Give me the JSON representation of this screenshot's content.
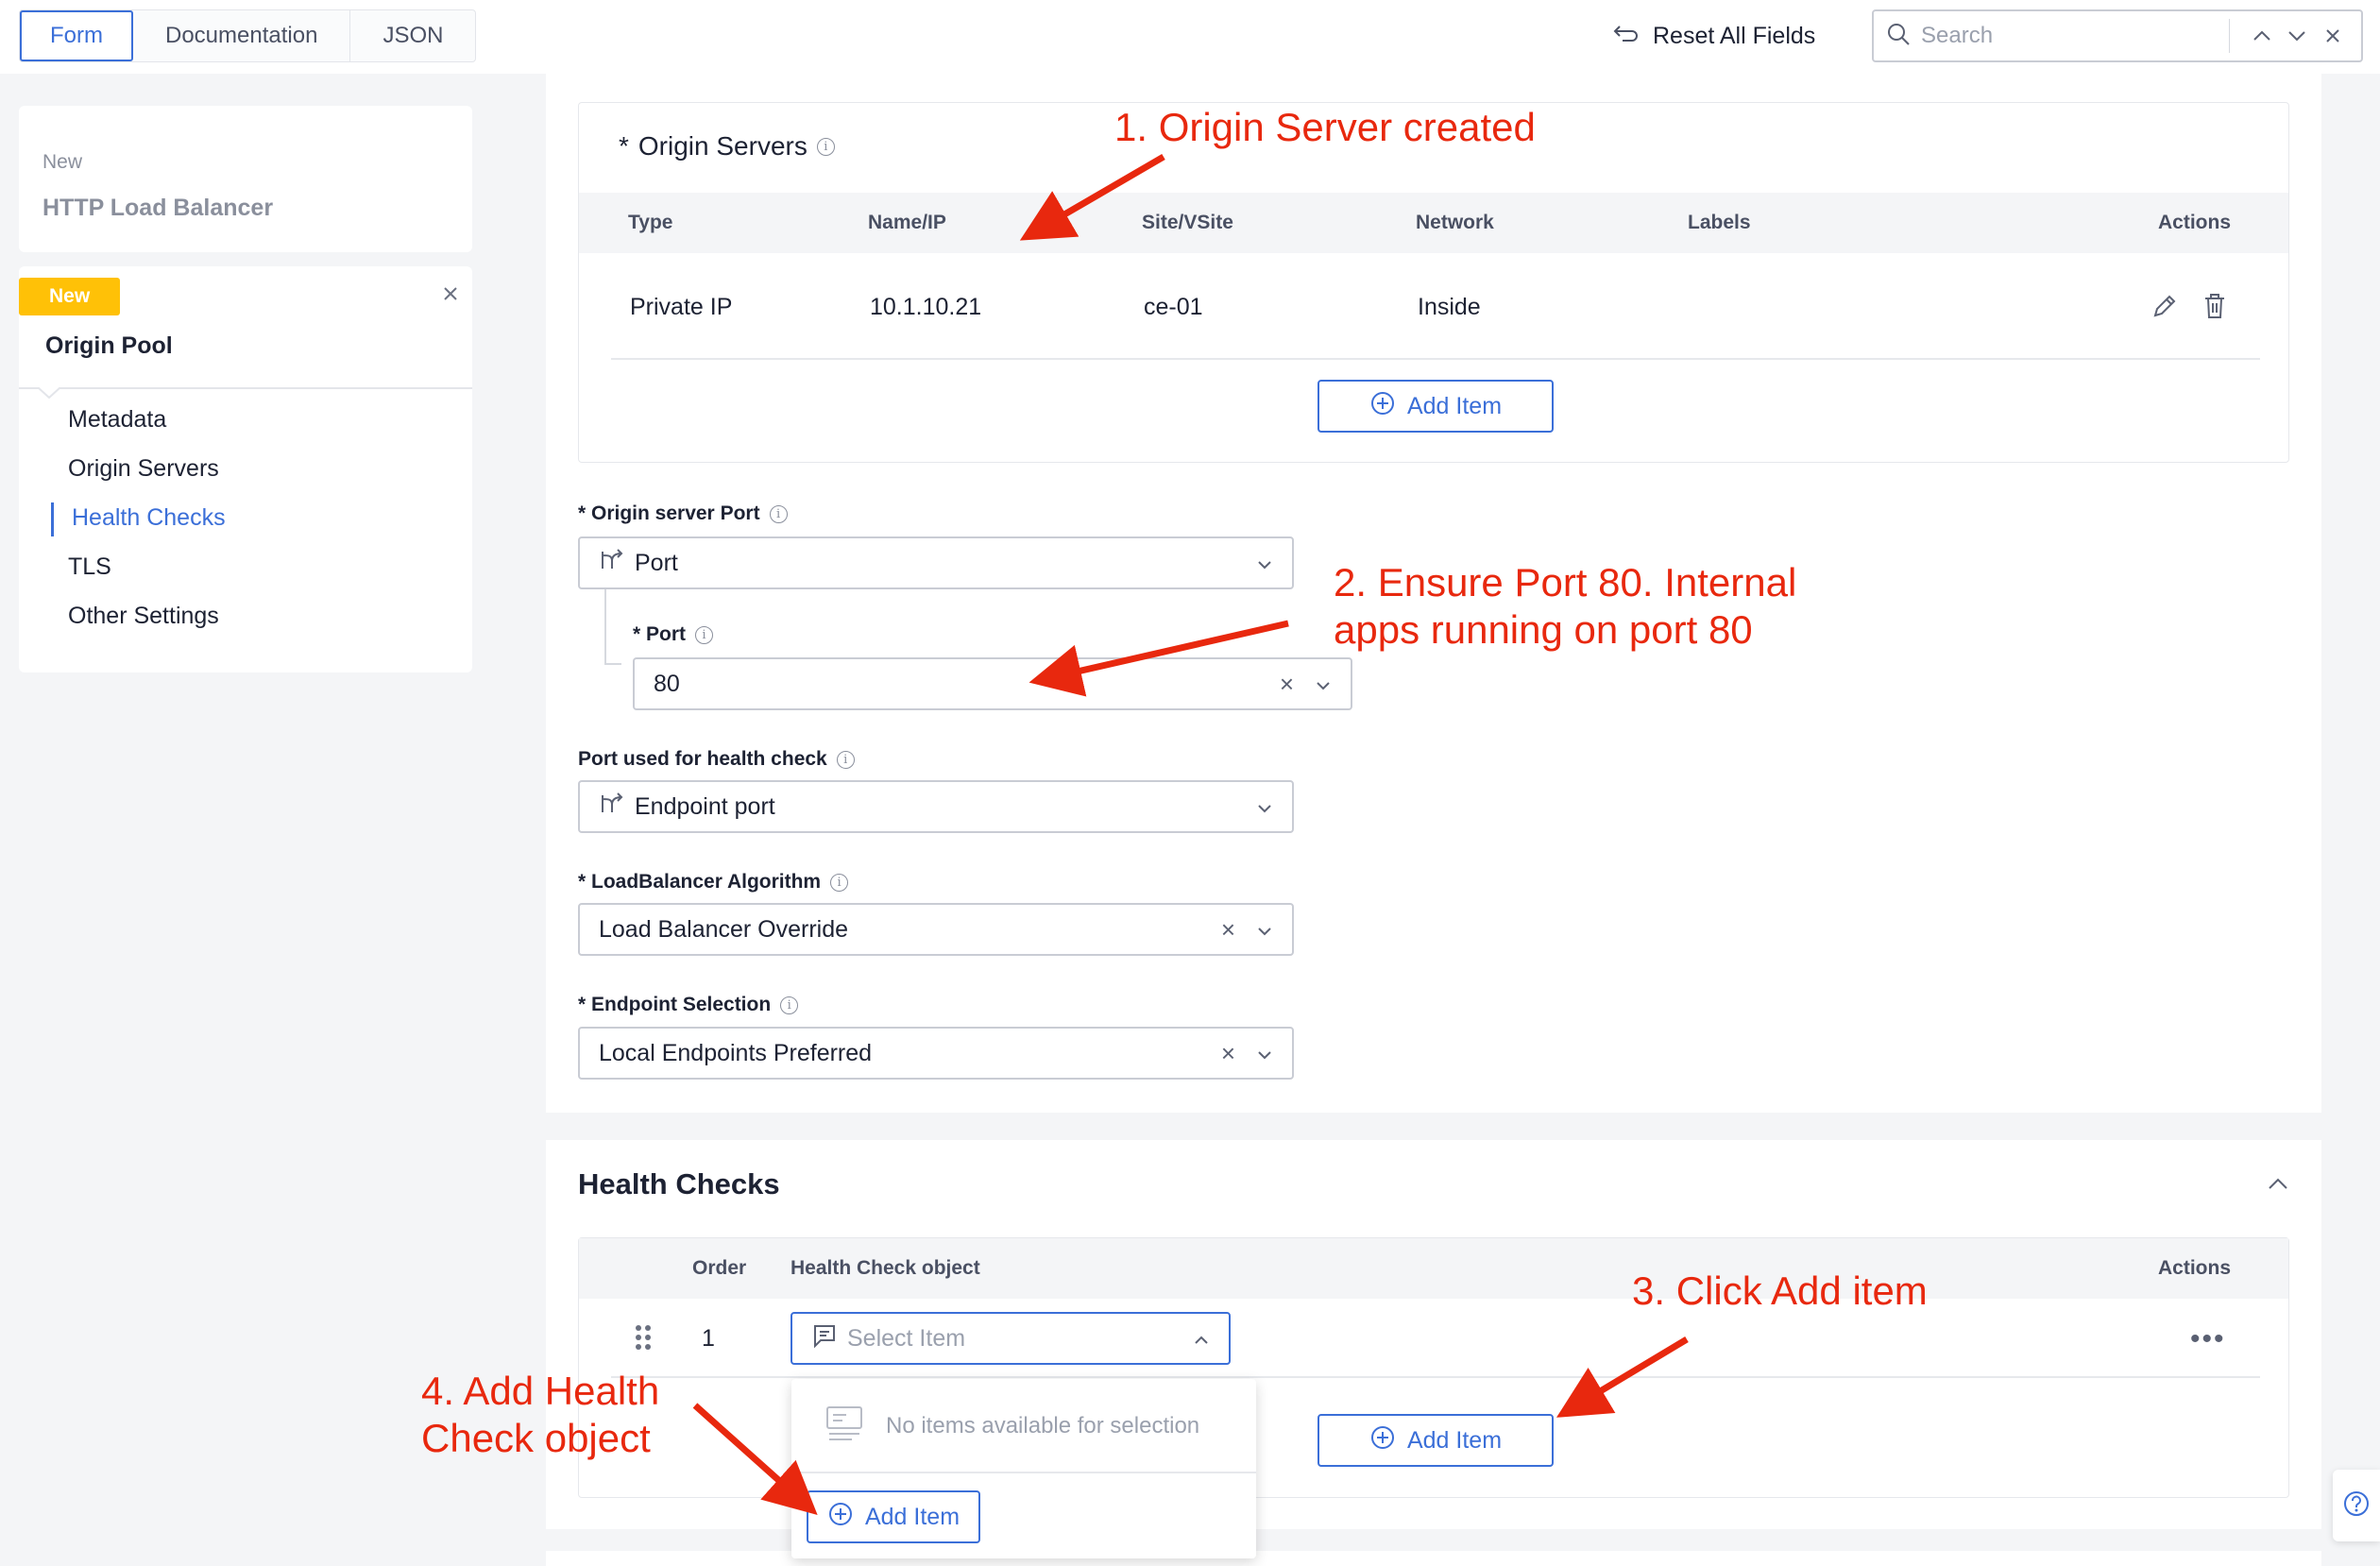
{
  "topbar": {
    "tabs": [
      "Form",
      "Documentation",
      "JSON"
    ],
    "reset_label": "Reset All Fields",
    "search_placeholder": "Search"
  },
  "sidebar": {
    "parent_badge": "New",
    "parent_title": "HTTP Load Balancer",
    "current_badge": "New",
    "current_title": "Origin Pool",
    "items": [
      {
        "label": "Metadata"
      },
      {
        "label": "Origin Servers"
      },
      {
        "label": "Health Checks"
      },
      {
        "label": "TLS"
      },
      {
        "label": "Other Settings"
      }
    ],
    "active_index": 2
  },
  "origin_servers": {
    "title": "Origin Servers",
    "required_mark": "*",
    "columns": [
      "Type",
      "Name/IP",
      "Site/VSite",
      "Network",
      "Labels",
      "Actions"
    ],
    "rows": [
      {
        "type": "Private IP",
        "name_ip": "10.1.10.21",
        "site": "ce-01",
        "network": "Inside",
        "labels": ""
      }
    ],
    "add_label": "Add Item"
  },
  "form": {
    "origin_port_label": "* Origin server Port",
    "origin_port_value": "Port",
    "port_label": "* Port",
    "port_value": "80",
    "hc_port_label": "Port used for health check",
    "hc_port_value": "Endpoint port",
    "lb_algo_label": "* LoadBalancer Algorithm",
    "lb_algo_value": "Load Balancer Override",
    "endpoint_label": "* Endpoint Selection",
    "endpoint_value": "Local Endpoints Preferred"
  },
  "health_checks": {
    "title": "Health Checks",
    "columns": [
      "Order",
      "Health Check object",
      "Actions"
    ],
    "rows": [
      {
        "order": "1",
        "placeholder": "Select Item"
      }
    ],
    "dropdown_empty": "No items available for selection",
    "dropdown_add": "Add Item",
    "add_label": "Add Item"
  },
  "annotations": [
    {
      "text": "1. Origin Server created"
    },
    {
      "text": "2. Ensure Port 80. Internal apps running on port 80"
    },
    {
      "text": "3. Click Add item"
    },
    {
      "text": "4. Add Health Check object"
    }
  ],
  "colors": {
    "accent": "#3b6fd8",
    "badge": "#ffc107",
    "annotation": "#e8280e"
  }
}
